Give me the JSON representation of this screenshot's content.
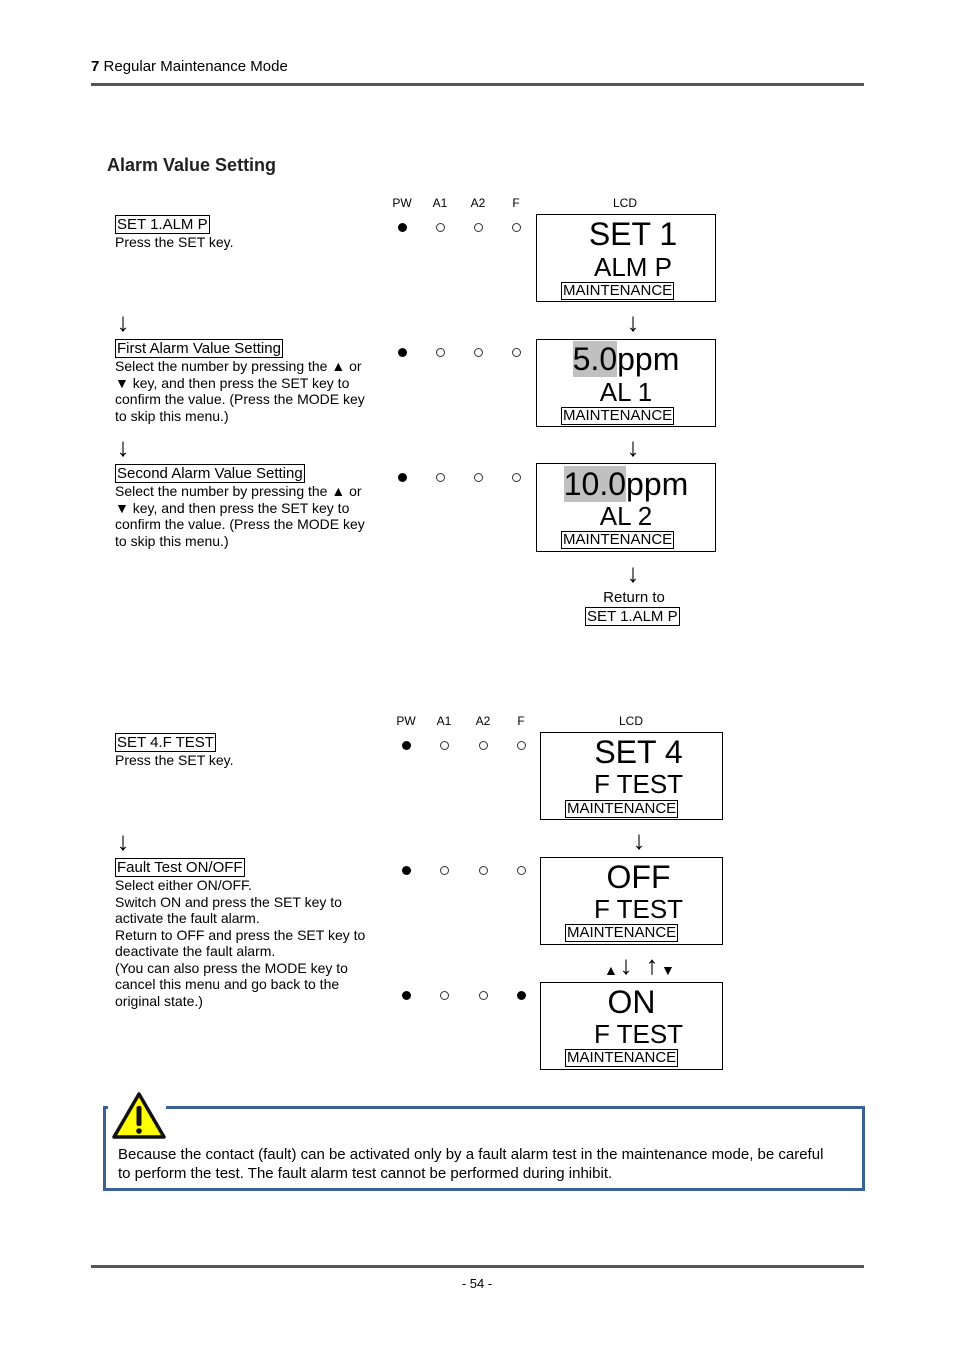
{
  "header": {
    "chapter_number": "7",
    "chapter_title": "Regular Maintenance Mode"
  },
  "section_title": "Alarm Value Setting",
  "led_labels": [
    "PW",
    "A1",
    "A2",
    "F"
  ],
  "lcd_label": "LCD",
  "flow1": {
    "steps": [
      {
        "title": "SET 1.ALM P",
        "description": [
          "Press the SET key."
        ],
        "leds": [
          "on",
          "off",
          "off",
          "off"
        ],
        "lcd": {
          "line1": "SET 1",
          "line1_highlight": "",
          "line2": "ALM P",
          "mode": "MAINTENANCE"
        }
      },
      {
        "title": "First Alarm Value Setting",
        "description": [
          "Select the number by pressing the ▲ or",
          "▼ key, and then press the SET key to",
          "confirm the value. (Press the MODE key",
          "to skip this menu.)"
        ],
        "leds": [
          "on",
          "off",
          "off",
          "off"
        ],
        "lcd": {
          "line1": "ppm",
          "line1_highlight": "5.0",
          "line2": "AL 1",
          "mode": "MAINTENANCE"
        }
      },
      {
        "title": "Second Alarm Value Setting",
        "description": [
          "Select the number by pressing the ▲ or",
          "▼ key, and then press the SET key to",
          "confirm the value. (Press the MODE key",
          "to skip this menu.)"
        ],
        "leds": [
          "on",
          "off",
          "off",
          "off"
        ],
        "lcd": {
          "line1": "ppm",
          "line1_highlight": "10.0",
          "line2": "AL 2",
          "mode": "MAINTENANCE"
        }
      }
    ],
    "return_text": "Return to",
    "return_target": "SET 1.ALM P"
  },
  "flow2": {
    "steps": [
      {
        "title": "SET 4.F TEST",
        "description": [
          "Press the SET key."
        ],
        "leds": [
          "on",
          "off",
          "off",
          "off"
        ],
        "lcd": {
          "line1": "SET 4",
          "line2": "F TEST",
          "mode": "MAINTENANCE"
        }
      },
      {
        "title": "Fault Test ON/OFF",
        "description": [
          "Select either ON/OFF.",
          "Switch ON and press the SET key to",
          "activate the fault alarm.",
          "Return to OFF and press the SET key to",
          "deactivate the fault alarm.",
          "(You can also press the MODE key to",
          "cancel this menu and go back to the",
          "original state.)"
        ],
        "leds": [
          "on",
          "off",
          "off",
          "off"
        ],
        "lcd": {
          "line1": "OFF",
          "line2": "F TEST",
          "mode": "MAINTENANCE"
        }
      },
      {
        "leds": [
          "on",
          "off",
          "off",
          "on"
        ],
        "lcd": {
          "line1": "ON",
          "line2": "F TEST",
          "mode": "MAINTENANCE"
        }
      }
    ],
    "toggle_up_key": "▲",
    "toggle_down_key": "▼"
  },
  "caution": {
    "icon": "warning-triangle-icon",
    "lines": [
      "Because the contact (fault) can be activated only by a fault alarm test in the maintenance mode, be careful",
      "to perform the test. The fault alarm test cannot be performed during inhibit."
    ]
  },
  "footer": {
    "page_number": "- 54 -"
  }
}
